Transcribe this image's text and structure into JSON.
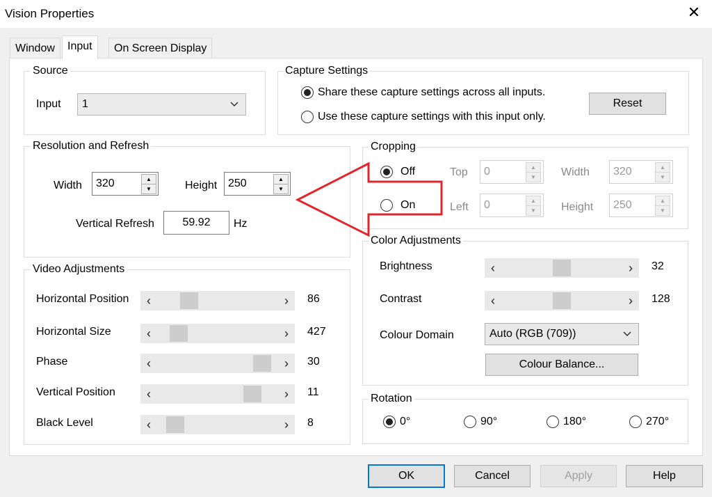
{
  "window": {
    "title": "Vision Properties",
    "close_glyph": "✕"
  },
  "tabs": [
    {
      "label": "Window"
    },
    {
      "label": "Input"
    },
    {
      "label": "On Screen Display"
    }
  ],
  "source": {
    "legend": "Source",
    "input_label": "Input",
    "input_value": "1"
  },
  "capture": {
    "legend": "Capture Settings",
    "option_share": "Share these capture settings across all inputs.",
    "option_this": "Use these capture settings with this input only.",
    "selected": "share",
    "reset_label": "Reset"
  },
  "resolution": {
    "legend": "Resolution and Refresh",
    "width_label": "Width",
    "width_value": "320",
    "height_label": "Height",
    "height_value": "250",
    "refresh_label": "Vertical Refresh",
    "refresh_value": "59.92",
    "refresh_unit": "Hz"
  },
  "cropping": {
    "legend": "Cropping",
    "off_label": "Off",
    "on_label": "On",
    "selected": "off",
    "top_label": "Top",
    "top_value": "0",
    "left_label": "Left",
    "left_value": "0",
    "width_label": "Width",
    "width_value": "320",
    "height_label": "Height",
    "height_value": "250"
  },
  "video": {
    "legend": "Video Adjustments",
    "rows": [
      {
        "label": "Horizontal Position",
        "value": "86",
        "fraction": 0.22
      },
      {
        "label": "Horizontal Size",
        "value": "427",
        "fraction": 0.12
      },
      {
        "label": "Phase",
        "value": "30",
        "fraction": 0.93
      },
      {
        "label": "Vertical Position",
        "value": "11",
        "fraction": 0.84
      },
      {
        "label": "Black Level",
        "value": "8",
        "fraction": 0.09
      }
    ]
  },
  "color": {
    "legend": "Color Adjustments",
    "brightness_label": "Brightness",
    "brightness_value": "32",
    "brightness_fraction": 0.5,
    "contrast_label": "Contrast",
    "contrast_value": "128",
    "contrast_fraction": 0.5,
    "domain_label": "Colour Domain",
    "domain_value": "Auto (RGB (709))",
    "balance_label": "Colour Balance..."
  },
  "rotation": {
    "legend": "Rotation",
    "options": [
      "0°",
      "90°",
      "180°",
      "270°"
    ],
    "selected": "0°"
  },
  "buttons": {
    "ok": "OK",
    "cancel": "Cancel",
    "apply": "Apply",
    "help": "Help"
  },
  "annotation": {
    "arrow_color": "#e0262b"
  },
  "icons": {
    "arrow_left": "‹",
    "arrow_right": "›",
    "chevron": "chevron-down-icon"
  }
}
